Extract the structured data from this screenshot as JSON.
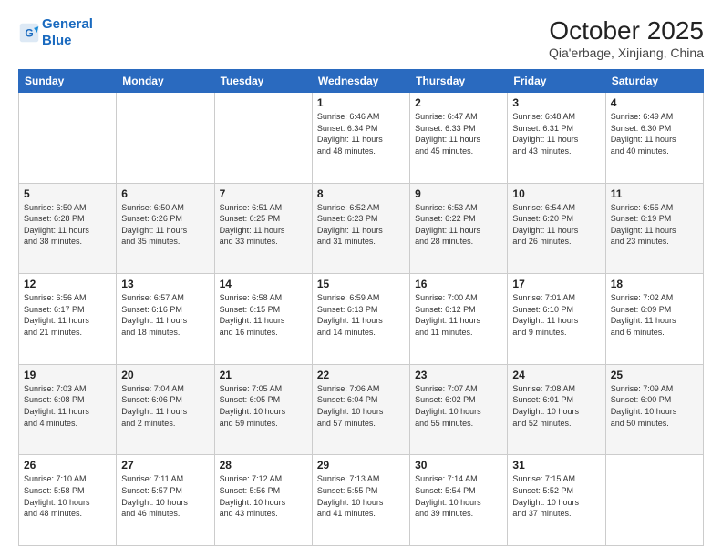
{
  "header": {
    "logo_line1": "General",
    "logo_line2": "Blue",
    "month_title": "October 2025",
    "location": "Qia'erbage, Xinjiang, China"
  },
  "days_of_week": [
    "Sunday",
    "Monday",
    "Tuesday",
    "Wednesday",
    "Thursday",
    "Friday",
    "Saturday"
  ],
  "weeks": [
    [
      {
        "day": "",
        "info": ""
      },
      {
        "day": "",
        "info": ""
      },
      {
        "day": "",
        "info": ""
      },
      {
        "day": "1",
        "info": "Sunrise: 6:46 AM\nSunset: 6:34 PM\nDaylight: 11 hours\nand 48 minutes."
      },
      {
        "day": "2",
        "info": "Sunrise: 6:47 AM\nSunset: 6:33 PM\nDaylight: 11 hours\nand 45 minutes."
      },
      {
        "day": "3",
        "info": "Sunrise: 6:48 AM\nSunset: 6:31 PM\nDaylight: 11 hours\nand 43 minutes."
      },
      {
        "day": "4",
        "info": "Sunrise: 6:49 AM\nSunset: 6:30 PM\nDaylight: 11 hours\nand 40 minutes."
      }
    ],
    [
      {
        "day": "5",
        "info": "Sunrise: 6:50 AM\nSunset: 6:28 PM\nDaylight: 11 hours\nand 38 minutes."
      },
      {
        "day": "6",
        "info": "Sunrise: 6:50 AM\nSunset: 6:26 PM\nDaylight: 11 hours\nand 35 minutes."
      },
      {
        "day": "7",
        "info": "Sunrise: 6:51 AM\nSunset: 6:25 PM\nDaylight: 11 hours\nand 33 minutes."
      },
      {
        "day": "8",
        "info": "Sunrise: 6:52 AM\nSunset: 6:23 PM\nDaylight: 11 hours\nand 31 minutes."
      },
      {
        "day": "9",
        "info": "Sunrise: 6:53 AM\nSunset: 6:22 PM\nDaylight: 11 hours\nand 28 minutes."
      },
      {
        "day": "10",
        "info": "Sunrise: 6:54 AM\nSunset: 6:20 PM\nDaylight: 11 hours\nand 26 minutes."
      },
      {
        "day": "11",
        "info": "Sunrise: 6:55 AM\nSunset: 6:19 PM\nDaylight: 11 hours\nand 23 minutes."
      }
    ],
    [
      {
        "day": "12",
        "info": "Sunrise: 6:56 AM\nSunset: 6:17 PM\nDaylight: 11 hours\nand 21 minutes."
      },
      {
        "day": "13",
        "info": "Sunrise: 6:57 AM\nSunset: 6:16 PM\nDaylight: 11 hours\nand 18 minutes."
      },
      {
        "day": "14",
        "info": "Sunrise: 6:58 AM\nSunset: 6:15 PM\nDaylight: 11 hours\nand 16 minutes."
      },
      {
        "day": "15",
        "info": "Sunrise: 6:59 AM\nSunset: 6:13 PM\nDaylight: 11 hours\nand 14 minutes."
      },
      {
        "day": "16",
        "info": "Sunrise: 7:00 AM\nSunset: 6:12 PM\nDaylight: 11 hours\nand 11 minutes."
      },
      {
        "day": "17",
        "info": "Sunrise: 7:01 AM\nSunset: 6:10 PM\nDaylight: 11 hours\nand 9 minutes."
      },
      {
        "day": "18",
        "info": "Sunrise: 7:02 AM\nSunset: 6:09 PM\nDaylight: 11 hours\nand 6 minutes."
      }
    ],
    [
      {
        "day": "19",
        "info": "Sunrise: 7:03 AM\nSunset: 6:08 PM\nDaylight: 11 hours\nand 4 minutes."
      },
      {
        "day": "20",
        "info": "Sunrise: 7:04 AM\nSunset: 6:06 PM\nDaylight: 11 hours\nand 2 minutes."
      },
      {
        "day": "21",
        "info": "Sunrise: 7:05 AM\nSunset: 6:05 PM\nDaylight: 10 hours\nand 59 minutes."
      },
      {
        "day": "22",
        "info": "Sunrise: 7:06 AM\nSunset: 6:04 PM\nDaylight: 10 hours\nand 57 minutes."
      },
      {
        "day": "23",
        "info": "Sunrise: 7:07 AM\nSunset: 6:02 PM\nDaylight: 10 hours\nand 55 minutes."
      },
      {
        "day": "24",
        "info": "Sunrise: 7:08 AM\nSunset: 6:01 PM\nDaylight: 10 hours\nand 52 minutes."
      },
      {
        "day": "25",
        "info": "Sunrise: 7:09 AM\nSunset: 6:00 PM\nDaylight: 10 hours\nand 50 minutes."
      }
    ],
    [
      {
        "day": "26",
        "info": "Sunrise: 7:10 AM\nSunset: 5:58 PM\nDaylight: 10 hours\nand 48 minutes."
      },
      {
        "day": "27",
        "info": "Sunrise: 7:11 AM\nSunset: 5:57 PM\nDaylight: 10 hours\nand 46 minutes."
      },
      {
        "day": "28",
        "info": "Sunrise: 7:12 AM\nSunset: 5:56 PM\nDaylight: 10 hours\nand 43 minutes."
      },
      {
        "day": "29",
        "info": "Sunrise: 7:13 AM\nSunset: 5:55 PM\nDaylight: 10 hours\nand 41 minutes."
      },
      {
        "day": "30",
        "info": "Sunrise: 7:14 AM\nSunset: 5:54 PM\nDaylight: 10 hours\nand 39 minutes."
      },
      {
        "day": "31",
        "info": "Sunrise: 7:15 AM\nSunset: 5:52 PM\nDaylight: 10 hours\nand 37 minutes."
      },
      {
        "day": "",
        "info": ""
      }
    ]
  ]
}
